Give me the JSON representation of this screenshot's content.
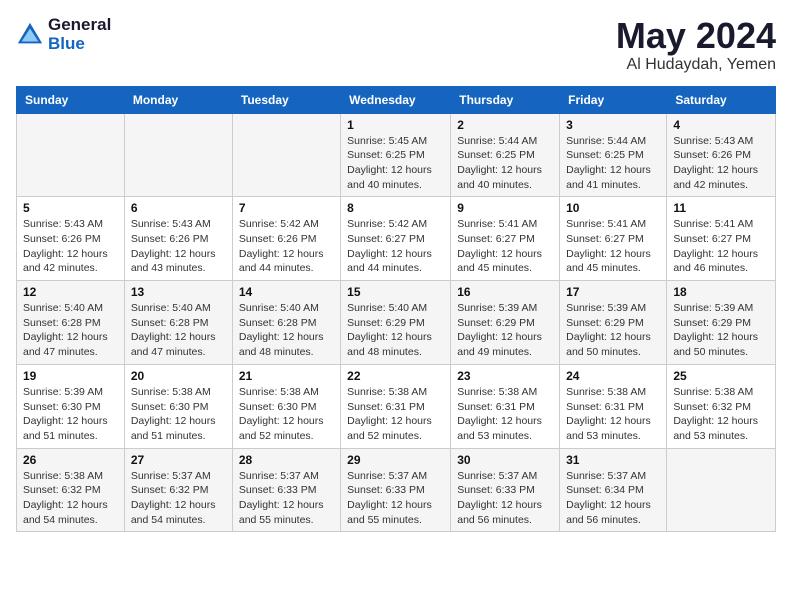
{
  "logo": {
    "general": "General",
    "blue": "Blue"
  },
  "title": {
    "month": "May 2024",
    "location": "Al Hudaydah, Yemen"
  },
  "weekdays": [
    "Sunday",
    "Monday",
    "Tuesday",
    "Wednesday",
    "Thursday",
    "Friday",
    "Saturday"
  ],
  "weeks": [
    [
      {
        "day": "",
        "info": ""
      },
      {
        "day": "",
        "info": ""
      },
      {
        "day": "",
        "info": ""
      },
      {
        "day": "1",
        "info": "Sunrise: 5:45 AM\nSunset: 6:25 PM\nDaylight: 12 hours\nand 40 minutes."
      },
      {
        "day": "2",
        "info": "Sunrise: 5:44 AM\nSunset: 6:25 PM\nDaylight: 12 hours\nand 40 minutes."
      },
      {
        "day": "3",
        "info": "Sunrise: 5:44 AM\nSunset: 6:25 PM\nDaylight: 12 hours\nand 41 minutes."
      },
      {
        "day": "4",
        "info": "Sunrise: 5:43 AM\nSunset: 6:26 PM\nDaylight: 12 hours\nand 42 minutes."
      }
    ],
    [
      {
        "day": "5",
        "info": "Sunrise: 5:43 AM\nSunset: 6:26 PM\nDaylight: 12 hours\nand 42 minutes."
      },
      {
        "day": "6",
        "info": "Sunrise: 5:43 AM\nSunset: 6:26 PM\nDaylight: 12 hours\nand 43 minutes."
      },
      {
        "day": "7",
        "info": "Sunrise: 5:42 AM\nSunset: 6:26 PM\nDaylight: 12 hours\nand 44 minutes."
      },
      {
        "day": "8",
        "info": "Sunrise: 5:42 AM\nSunset: 6:27 PM\nDaylight: 12 hours\nand 44 minutes."
      },
      {
        "day": "9",
        "info": "Sunrise: 5:41 AM\nSunset: 6:27 PM\nDaylight: 12 hours\nand 45 minutes."
      },
      {
        "day": "10",
        "info": "Sunrise: 5:41 AM\nSunset: 6:27 PM\nDaylight: 12 hours\nand 45 minutes."
      },
      {
        "day": "11",
        "info": "Sunrise: 5:41 AM\nSunset: 6:27 PM\nDaylight: 12 hours\nand 46 minutes."
      }
    ],
    [
      {
        "day": "12",
        "info": "Sunrise: 5:40 AM\nSunset: 6:28 PM\nDaylight: 12 hours\nand 47 minutes."
      },
      {
        "day": "13",
        "info": "Sunrise: 5:40 AM\nSunset: 6:28 PM\nDaylight: 12 hours\nand 47 minutes."
      },
      {
        "day": "14",
        "info": "Sunrise: 5:40 AM\nSunset: 6:28 PM\nDaylight: 12 hours\nand 48 minutes."
      },
      {
        "day": "15",
        "info": "Sunrise: 5:40 AM\nSunset: 6:29 PM\nDaylight: 12 hours\nand 48 minutes."
      },
      {
        "day": "16",
        "info": "Sunrise: 5:39 AM\nSunset: 6:29 PM\nDaylight: 12 hours\nand 49 minutes."
      },
      {
        "day": "17",
        "info": "Sunrise: 5:39 AM\nSunset: 6:29 PM\nDaylight: 12 hours\nand 50 minutes."
      },
      {
        "day": "18",
        "info": "Sunrise: 5:39 AM\nSunset: 6:29 PM\nDaylight: 12 hours\nand 50 minutes."
      }
    ],
    [
      {
        "day": "19",
        "info": "Sunrise: 5:39 AM\nSunset: 6:30 PM\nDaylight: 12 hours\nand 51 minutes."
      },
      {
        "day": "20",
        "info": "Sunrise: 5:38 AM\nSunset: 6:30 PM\nDaylight: 12 hours\nand 51 minutes."
      },
      {
        "day": "21",
        "info": "Sunrise: 5:38 AM\nSunset: 6:30 PM\nDaylight: 12 hours\nand 52 minutes."
      },
      {
        "day": "22",
        "info": "Sunrise: 5:38 AM\nSunset: 6:31 PM\nDaylight: 12 hours\nand 52 minutes."
      },
      {
        "day": "23",
        "info": "Sunrise: 5:38 AM\nSunset: 6:31 PM\nDaylight: 12 hours\nand 53 minutes."
      },
      {
        "day": "24",
        "info": "Sunrise: 5:38 AM\nSunset: 6:31 PM\nDaylight: 12 hours\nand 53 minutes."
      },
      {
        "day": "25",
        "info": "Sunrise: 5:38 AM\nSunset: 6:32 PM\nDaylight: 12 hours\nand 53 minutes."
      }
    ],
    [
      {
        "day": "26",
        "info": "Sunrise: 5:38 AM\nSunset: 6:32 PM\nDaylight: 12 hours\nand 54 minutes."
      },
      {
        "day": "27",
        "info": "Sunrise: 5:37 AM\nSunset: 6:32 PM\nDaylight: 12 hours\nand 54 minutes."
      },
      {
        "day": "28",
        "info": "Sunrise: 5:37 AM\nSunset: 6:33 PM\nDaylight: 12 hours\nand 55 minutes."
      },
      {
        "day": "29",
        "info": "Sunrise: 5:37 AM\nSunset: 6:33 PM\nDaylight: 12 hours\nand 55 minutes."
      },
      {
        "day": "30",
        "info": "Sunrise: 5:37 AM\nSunset: 6:33 PM\nDaylight: 12 hours\nand 56 minutes."
      },
      {
        "day": "31",
        "info": "Sunrise: 5:37 AM\nSunset: 6:34 PM\nDaylight: 12 hours\nand 56 minutes."
      },
      {
        "day": "",
        "info": ""
      }
    ]
  ]
}
